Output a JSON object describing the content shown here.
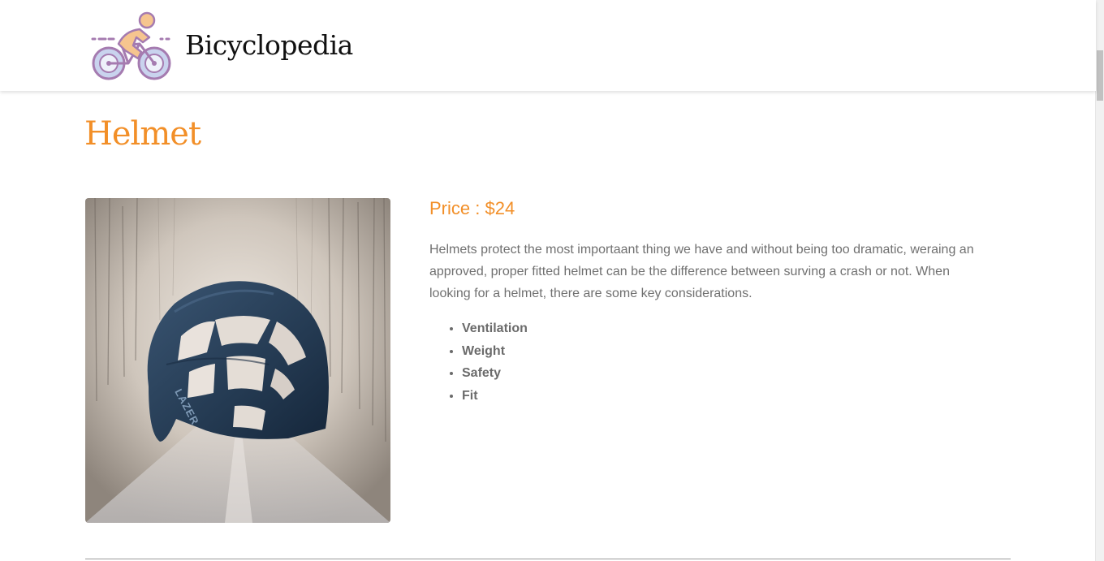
{
  "header": {
    "brand": "Bicyclopedia",
    "logo_icon": "cyclist-icon"
  },
  "product": {
    "title": "Helmet",
    "price_label": "Price : ",
    "price_value": "$24",
    "description": "Helmets protect the most importaant thing we have and without being too dramatic, weraing an approved, proper fitted helmet can be the difference between surving a crash or not. When looking for a helmet, there are some key considerations.",
    "features": [
      "Ventilation",
      "Weight",
      "Safety",
      "Fit"
    ],
    "image_icon": "helmet-photo",
    "helmet_lettering": "LAZER"
  },
  "colors": {
    "accent": "#f28f28",
    "text": "#707070",
    "helmet": "#24384f"
  }
}
